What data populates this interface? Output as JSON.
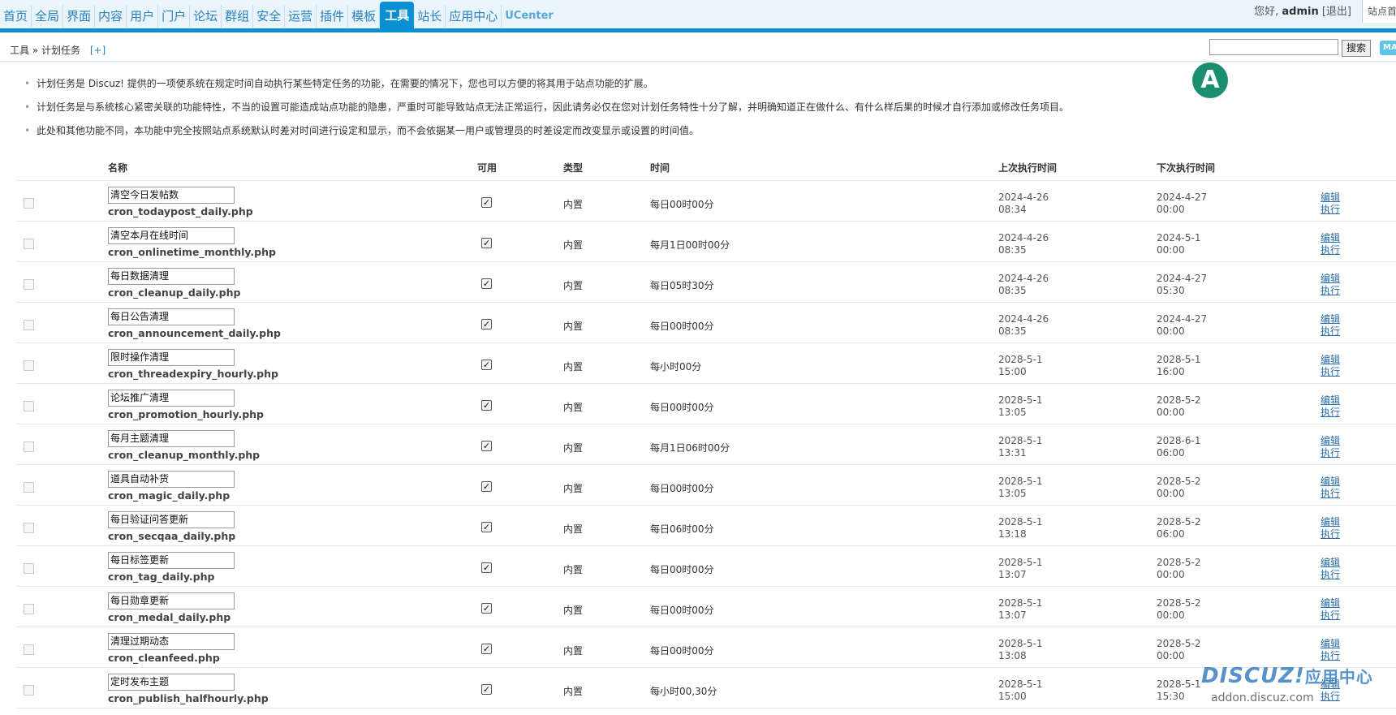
{
  "nav": {
    "items": [
      "首页",
      "全局",
      "界面",
      "内容",
      "用户",
      "门户",
      "论坛",
      "群组",
      "安全",
      "运营",
      "插件",
      "模板",
      "工具",
      "站长",
      "应用中心",
      "UCenter"
    ],
    "active": "工具"
  },
  "user": {
    "greeting": "您好,",
    "name": "admin",
    "logout": "[退出]",
    "site_button": "站点首页"
  },
  "breadcrumb": {
    "text": "工具 » 计划任务",
    "add": "[+]"
  },
  "search": {
    "placeholder": "",
    "button": "搜索",
    "map_button": "MAP"
  },
  "badge": "A",
  "tips": [
    "计划任务是 Discuz! 提供的一项使系统在规定时间自动执行某些特定任务的功能，在需要的情况下，您也可以方便的将其用于站点功能的扩展。",
    "计划任务是与系统核心紧密关联的功能特性，不当的设置可能造成站点功能的隐患，严重时可能导致站点无法正常运行，因此请务必仅在您对计划任务特性十分了解，并明确知道正在做什么、有什么样后果的时候才自行添加或修改任务项目。",
    "此处和其他功能不同，本功能中完全按照站点系统默认时差对时间进行设定和显示，而不会依据某一用户或管理员的时差设定而改变显示或设置的时间值。"
  ],
  "table": {
    "headers": {
      "name": "名称",
      "available": "可用",
      "type": "类型",
      "time": "时间",
      "last_run": "上次执行时间",
      "next_run": "下次执行时间"
    },
    "edit_label": "编辑",
    "run_label": "执行",
    "rows": [
      {
        "name": "清空今日发帖数",
        "script": "cron_todaypost_daily.php",
        "type": "内置",
        "time": "每日00时00分",
        "last_date": "2024-4-26",
        "last_time": "08:34",
        "next_date": "2024-4-27",
        "next_time": "00:00"
      },
      {
        "name": "清空本月在线时间",
        "script": "cron_onlinetime_monthly.php",
        "type": "内置",
        "time": "每月1日00时00分",
        "last_date": "2024-4-26",
        "last_time": "08:35",
        "next_date": "2024-5-1",
        "next_time": "00:00"
      },
      {
        "name": "每日数据清理",
        "script": "cron_cleanup_daily.php",
        "type": "内置",
        "time": "每日05时30分",
        "last_date": "2024-4-26",
        "last_time": "08:35",
        "next_date": "2024-4-27",
        "next_time": "05:30"
      },
      {
        "name": "每日公告清理",
        "script": "cron_announcement_daily.php",
        "type": "内置",
        "time": "每日00时00分",
        "last_date": "2024-4-26",
        "last_time": "08:35",
        "next_date": "2024-4-27",
        "next_time": "00:00"
      },
      {
        "name": "限时操作清理",
        "script": "cron_threadexpiry_hourly.php",
        "type": "内置",
        "time": "每小时00分",
        "last_date": "2028-5-1",
        "last_time": "15:00",
        "next_date": "2028-5-1",
        "next_time": "16:00"
      },
      {
        "name": "论坛推广清理",
        "script": "cron_promotion_hourly.php",
        "type": "内置",
        "time": "每日00时00分",
        "last_date": "2028-5-1",
        "last_time": "13:05",
        "next_date": "2028-5-2",
        "next_time": "00:00"
      },
      {
        "name": "每月主题清理",
        "script": "cron_cleanup_monthly.php",
        "type": "内置",
        "time": "每月1日06时00分",
        "last_date": "2028-5-1",
        "last_time": "13:31",
        "next_date": "2028-6-1",
        "next_time": "06:00"
      },
      {
        "name": "道具自动补货",
        "script": "cron_magic_daily.php",
        "type": "内置",
        "time": "每日00时00分",
        "last_date": "2028-5-1",
        "last_time": "13:05",
        "next_date": "2028-5-2",
        "next_time": "00:00"
      },
      {
        "name": "每日验证问答更新",
        "script": "cron_secqaa_daily.php",
        "type": "内置",
        "time": "每日06时00分",
        "last_date": "2028-5-1",
        "last_time": "13:18",
        "next_date": "2028-5-2",
        "next_time": "06:00"
      },
      {
        "name": "每日标签更新",
        "script": "cron_tag_daily.php",
        "type": "内置",
        "time": "每日00时00分",
        "last_date": "2028-5-1",
        "last_time": "13:07",
        "next_date": "2028-5-2",
        "next_time": "00:00"
      },
      {
        "name": "每日勋章更新",
        "script": "cron_medal_daily.php",
        "type": "内置",
        "time": "每日00时00分",
        "last_date": "2028-5-1",
        "last_time": "13:07",
        "next_date": "2028-5-2",
        "next_time": "00:00"
      },
      {
        "name": "清理过期动态",
        "script": "cron_cleanfeed.php",
        "type": "内置",
        "time": "每日00时00分",
        "last_date": "2028-5-1",
        "last_time": "13:08",
        "next_date": "2028-5-2",
        "next_time": "00:00"
      },
      {
        "name": "定时发布主题",
        "script": "cron_publish_halfhourly.php",
        "type": "内置",
        "time": "每小时00,30分",
        "last_date": "2028-5-1",
        "last_time": "15:00",
        "next_date": "2028-5-1",
        "next_time": "15:30"
      }
    ]
  },
  "watermark": {
    "logo": "DISCUZ!",
    "logo_cn": "应用中心",
    "url": "addon.discuz.com"
  }
}
